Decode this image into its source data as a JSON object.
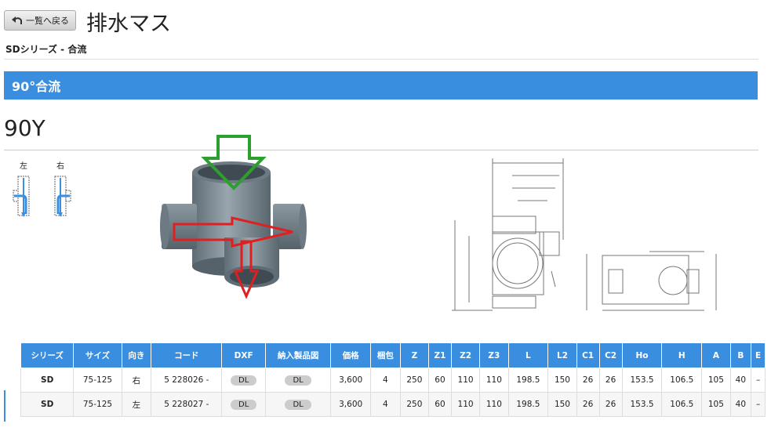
{
  "header": {
    "back_label": "一覧へ戻る",
    "title": "排水マス",
    "subtitle": "SDシリーズ - 合流"
  },
  "section": {
    "label": "90°合流"
  },
  "model": "90Y",
  "directions": {
    "left": "左",
    "right": "右"
  },
  "table": {
    "columns": [
      "シリーズ",
      "サイズ",
      "向き",
      "コード",
      "DXF",
      "納入製品図",
      "価格",
      "梱包",
      "Z",
      "Z1",
      "Z2",
      "Z3",
      "L",
      "L2",
      "C1",
      "C2",
      "Ho",
      "H",
      "A",
      "B",
      "E"
    ],
    "rows": [
      [
        "SD",
        "75-125",
        "右",
        "5 228026 -",
        "DL",
        "DL",
        "3,600",
        "4",
        "250",
        "60",
        "110",
        "110",
        "198.5",
        "150",
        "26",
        "26",
        "153.5",
        "106.5",
        "105",
        "40",
        "–"
      ],
      [
        "SD",
        "75-125",
        "左",
        "5 228027 -",
        "DL",
        "DL",
        "3,600",
        "4",
        "250",
        "60",
        "110",
        "110",
        "198.5",
        "150",
        "26",
        "26",
        "153.5",
        "106.5",
        "105",
        "40",
        "–"
      ]
    ]
  },
  "colors": {
    "accent": "#3a8ee0",
    "arrow_in": "#2ca02c",
    "arrow_out": "#e02020",
    "pipe": "#7e8b94"
  },
  "icons": {
    "back": "undo-arrow-icon"
  }
}
